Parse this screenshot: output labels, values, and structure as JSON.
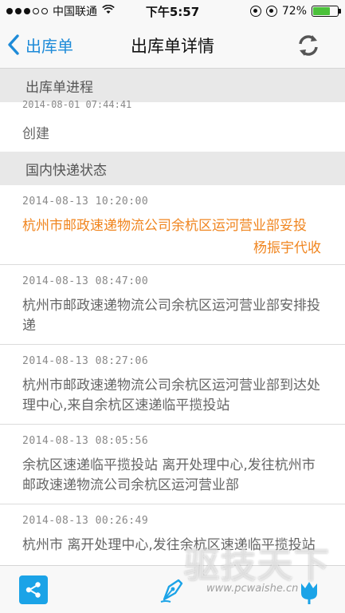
{
  "status_bar": {
    "carrier": "中国联通",
    "time": "下午5:57",
    "battery_percent": "72%",
    "battery_level": 0.72
  },
  "nav": {
    "back_label": "出库单",
    "title": "出库单详情"
  },
  "progress_section": {
    "header": "出库单进程",
    "entries": [
      {
        "time": "2014-08-01 07:44:41",
        "status": "创建"
      }
    ]
  },
  "express_section": {
    "header": "国内快递状态",
    "items": [
      {
        "time": "2014-08-13 10:20:00",
        "text": "杭州市邮政速递物流公司余杭区运河营业部妥投",
        "signer": "杨振宇代收"
      },
      {
        "time": "2014-08-13 08:47:00",
        "text": "杭州市邮政速递物流公司余杭区运河营业部安排投递"
      },
      {
        "time": "2014-08-13 08:27:06",
        "text": "杭州市邮政速递物流公司余杭区运河营业部到达处理中心,来自余杭区速递临平揽投站"
      },
      {
        "time": "2014-08-13 08:05:56",
        "text": "余杭区速递临平揽投站 离开处理中心,发往杭州市邮政速递物流公司余杭区运河营业部"
      },
      {
        "time": "2014-08-13 00:26:49",
        "text": "杭州市 离开处理中心,发往余杭区速递临平揽投站"
      }
    ]
  },
  "watermark": {
    "title": "驱技天下",
    "url": "www.pcwaishe.cn"
  },
  "colors": {
    "accent": "#1e8bd8",
    "highlight": "#f0851f",
    "share_bg": "#1ba3e7",
    "battery": "#4bc13a"
  },
  "icons": {
    "back": "chevron-left-icon",
    "refresh": "refresh-icon",
    "share": "share-icon",
    "pen": "pen-nib-icon",
    "tulip": "tulip-icon"
  }
}
